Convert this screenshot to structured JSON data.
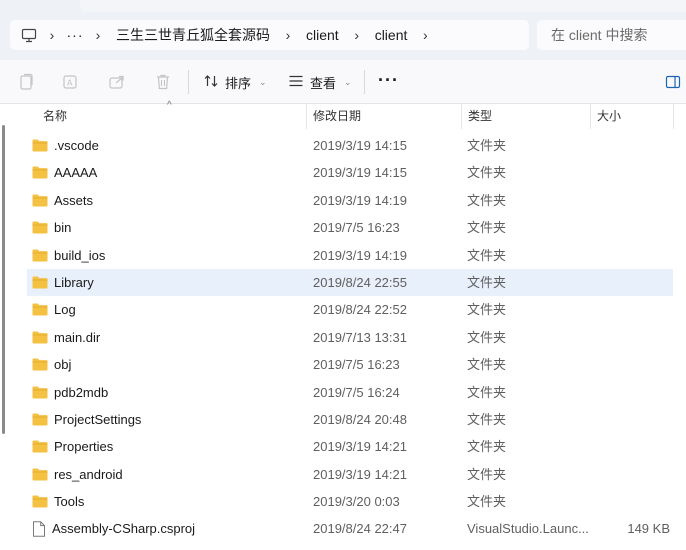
{
  "address": {
    "more_label": "···",
    "crumbs": [
      "三生三世青丘狐全套源码",
      "client",
      "client"
    ],
    "separator": "›"
  },
  "search": {
    "placeholder": "在 client 中搜索"
  },
  "toolbar": {
    "sort_label": "排序",
    "view_label": "查看",
    "more_label": "···"
  },
  "columns": {
    "name": "名称",
    "date": "修改日期",
    "type": "类型",
    "size": "大小"
  },
  "colors": {
    "folder": "#f5c142",
    "selected_row": "#e8f0fb"
  },
  "files": [
    {
      "name": ".vscode",
      "date": "2019/3/19 14:15",
      "type": "文件夹",
      "size": "",
      "kind": "folder"
    },
    {
      "name": "AAAAA",
      "date": "2019/3/19 14:15",
      "type": "文件夹",
      "size": "",
      "kind": "folder"
    },
    {
      "name": "Assets",
      "date": "2019/3/19 14:19",
      "type": "文件夹",
      "size": "",
      "kind": "folder"
    },
    {
      "name": "bin",
      "date": "2019/7/5 16:23",
      "type": "文件夹",
      "size": "",
      "kind": "folder"
    },
    {
      "name": "build_ios",
      "date": "2019/3/19 14:19",
      "type": "文件夹",
      "size": "",
      "kind": "folder"
    },
    {
      "name": "Library",
      "date": "2019/8/24 22:55",
      "type": "文件夹",
      "size": "",
      "kind": "folder",
      "selected": true
    },
    {
      "name": "Log",
      "date": "2019/8/24 22:52",
      "type": "文件夹",
      "size": "",
      "kind": "folder"
    },
    {
      "name": "main.dir",
      "date": "2019/7/13 13:31",
      "type": "文件夹",
      "size": "",
      "kind": "folder"
    },
    {
      "name": "obj",
      "date": "2019/7/5 16:23",
      "type": "文件夹",
      "size": "",
      "kind": "folder"
    },
    {
      "name": "pdb2mdb",
      "date": "2019/7/5 16:24",
      "type": "文件夹",
      "size": "",
      "kind": "folder"
    },
    {
      "name": "ProjectSettings",
      "date": "2019/8/24 20:48",
      "type": "文件夹",
      "size": "",
      "kind": "folder"
    },
    {
      "name": "Properties",
      "date": "2019/3/19 14:21",
      "type": "文件夹",
      "size": "",
      "kind": "folder"
    },
    {
      "name": "res_android",
      "date": "2019/3/19 14:21",
      "type": "文件夹",
      "size": "",
      "kind": "folder"
    },
    {
      "name": "Tools",
      "date": "2019/3/20 0:03",
      "type": "文件夹",
      "size": "",
      "kind": "folder"
    },
    {
      "name": "Assembly-CSharp.csproj",
      "date": "2019/8/24 22:47",
      "type": "VisualStudio.Launc...",
      "size": "149 KB",
      "kind": "file"
    }
  ]
}
